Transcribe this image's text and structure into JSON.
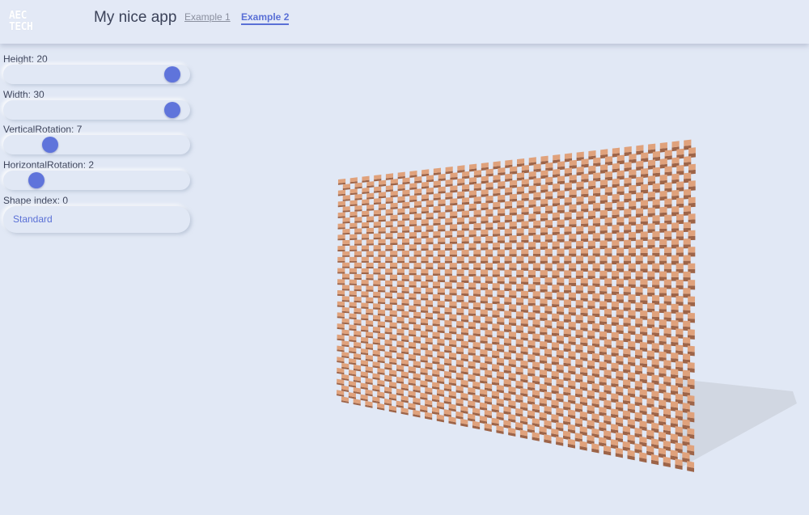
{
  "header": {
    "logo_line1": "AEC",
    "logo_line2": "TECH",
    "title": "My nice app",
    "nav": [
      {
        "label": "Example 1",
        "active": false
      },
      {
        "label": "Example 2",
        "active": true
      }
    ]
  },
  "controls": {
    "height": {
      "label": "Height: 20",
      "fraction": 0.95
    },
    "width": {
      "label": "Width: 30",
      "fraction": 0.95
    },
    "vertical_rotation": {
      "label": "VerticalRotation: 7",
      "fraction": 0.22
    },
    "horizontal_rotation": {
      "label": "HorizontalRotation: 2",
      "fraction": 0.14
    },
    "shape_index": {
      "label": "Shape index: 0"
    },
    "shape_button": {
      "label": "Standard"
    }
  },
  "scene": {
    "model": "brick-wall",
    "rows": 20,
    "columns": 30,
    "brick_color": "#e0a27c",
    "brick_shadow_color": "#9d6448",
    "background": "#e1e8f5",
    "accent": "#5f74db"
  }
}
